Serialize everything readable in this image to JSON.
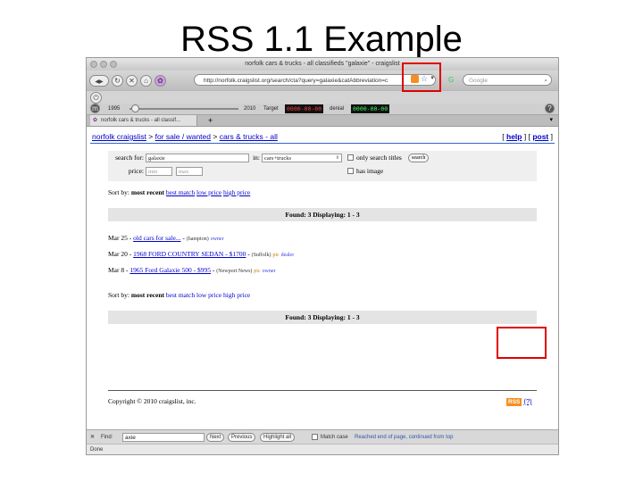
{
  "slide": {
    "title": "RSS 1.1 Example"
  },
  "browser": {
    "window_title": "norfolk cars & trucks - all classifieds \"galaxie\" - craigslist",
    "url": "http://norfolk.craigslist.org/search/cta?query=galaxie&catAbbreviation=c",
    "search_placeholder": "Google",
    "timeline": {
      "year_start": "1995",
      "year_end": "2010",
      "target_label": "Target",
      "target_value": "0000-00-00",
      "denial_label": "denial",
      "denial_value": "0000-00-00"
    },
    "tab_label": "norfolk cars & trucks - all classif...",
    "tab_add": "+",
    "tab_close": "▾",
    "find": {
      "label": "Find:",
      "value": "axie",
      "next": "Next",
      "previous": "Previous",
      "highlight": "Highlight all",
      "match_case": "Match case",
      "status": "Reached end of page, continued from top"
    },
    "status": "Done"
  },
  "colors": {
    "rss": "#f58f1f",
    "link": "#0000cc",
    "highlight_box": "#e00000"
  },
  "icons": {
    "nav_back": "◀",
    "nav_forward": "▶",
    "reload": "↻",
    "stop": "✕",
    "home": "⌂",
    "feed": "rss-icon",
    "bookmark": "star-icon",
    "addons": "m",
    "help": "?"
  },
  "page": {
    "crumbs": {
      "site": "norfolk craigslist",
      "sep1": " > ",
      "section": "for sale / wanted",
      "sep2": " > ",
      "category": "cars & trucks - all"
    },
    "help_label": "help",
    "post_label": "post",
    "search": {
      "search_for_label": "search for:",
      "search_value": "galaxie",
      "in_label": "in:",
      "category_value": "cars+trucks",
      "only_titles_label": "only search titles",
      "search_button": "search",
      "price_label": "price:",
      "min_placeholder": "min",
      "max_placeholder": "max",
      "has_image_label": "has image"
    },
    "sort": {
      "prefix": "Sort by:",
      "most_recent": "most recent",
      "best_match": "best match",
      "low_price": "low price",
      "high_price": "high price"
    },
    "found_text": "Found: 3 Displaying: 1 - 3",
    "listings": [
      {
        "date": "Mar 25",
        "title": "old cars for sale...",
        "location": "(hampton)",
        "pic": "",
        "kind": "owner"
      },
      {
        "date": "Mar 20",
        "title": "1968 FORD COUNTRY SEDAN - $1700",
        "location": "(Suffolk)",
        "pic": "pic",
        "kind": "dealer"
      },
      {
        "date": "Mar 8",
        "title": "1965 Ford Galaxie 500 - $995",
        "location": "(Newport News)",
        "pic": "pic",
        "kind": "owner"
      }
    ],
    "copyright": "Copyright © 2010 craigslist, inc.",
    "rss_label": "RSS",
    "rss_help": "(?)"
  }
}
